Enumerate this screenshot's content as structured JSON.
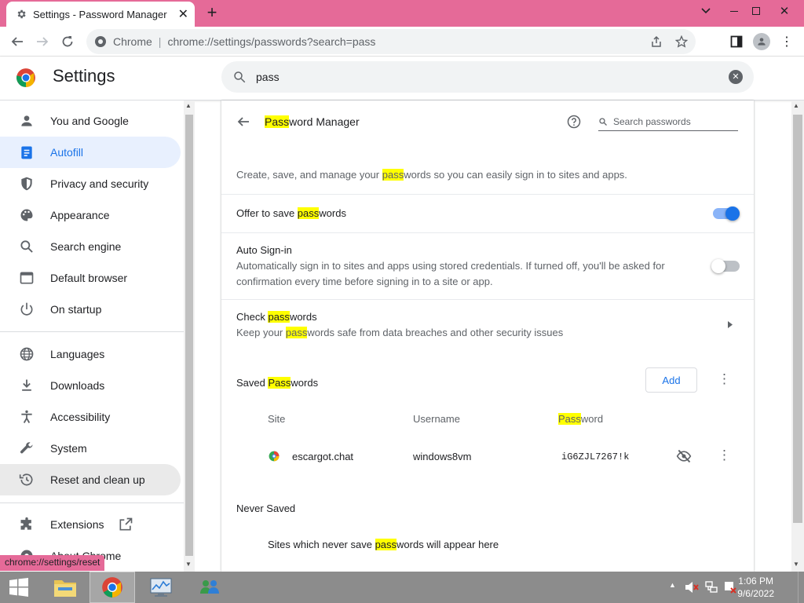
{
  "tab": {
    "title": "Settings - Password Manager"
  },
  "toolbar": {
    "omni_label": "Chrome",
    "url": "chrome://settings/passwords?search=pass"
  },
  "header": {
    "title": "Settings",
    "search_value": "pass"
  },
  "sidebar": {
    "items": [
      {
        "label": "You and Google",
        "icon": "person-icon"
      },
      {
        "label": "Autofill",
        "icon": "clipboard-icon"
      },
      {
        "label": "Privacy and security",
        "icon": "shield-icon"
      },
      {
        "label": "Appearance",
        "icon": "palette-icon"
      },
      {
        "label": "Search engine",
        "icon": "search-icon"
      },
      {
        "label": "Default browser",
        "icon": "browser-icon"
      },
      {
        "label": "On startup",
        "icon": "power-icon"
      },
      {
        "label": "Languages",
        "icon": "globe-icon"
      },
      {
        "label": "Downloads",
        "icon": "download-icon"
      },
      {
        "label": "Accessibility",
        "icon": "accessibility-icon"
      },
      {
        "label": "System",
        "icon": "wrench-icon"
      },
      {
        "label": "Reset and clean up",
        "icon": "history-icon"
      },
      {
        "label": "Extensions",
        "icon": "puzzle-icon"
      },
      {
        "label": "About Chrome",
        "icon": "chrome-icon"
      }
    ]
  },
  "pm": {
    "title_pre": "Pass",
    "title_post": "word Manager",
    "search_placeholder": "Search passwords",
    "desc_pre": "Create, save, and manage your ",
    "desc_hl": "pass",
    "desc_post": "words so you can easily sign in to sites and apps.",
    "offer_pre": "Offer to save ",
    "offer_hl": "pass",
    "offer_post": "words",
    "offer_on": true,
    "auto_title": "Auto Sign-in",
    "auto_desc1": "Automatically sign in to sites and apps using stored credentials. If turned off, you'll be asked for",
    "auto_desc2": "confirmation every time before signing in to a site or app.",
    "auto_on": false,
    "check_pre": "Check ",
    "check_hl": "pass",
    "check_post": "words",
    "check_desc_pre": "Keep your ",
    "check_desc_hl": "pass",
    "check_desc_post": "words safe from data breaches and other security issues",
    "saved_pre": "Saved ",
    "saved_hl": "Pass",
    "saved_post": "words",
    "add_label": "Add",
    "col_site": "Site",
    "col_user": "Username",
    "col_pass_hl": "Pass",
    "col_pass_post": "word",
    "entry": {
      "site": "escargot.chat",
      "username": "windows8vm",
      "password": "iG6ZJL7267!k"
    },
    "never_title": "Never Saved",
    "never_pre": "Sites which never save ",
    "never_hl": "pass",
    "never_post": "words will appear here"
  },
  "status_url": "chrome://settings/reset",
  "clock": {
    "time": "1:06 PM",
    "date": "9/6/2022"
  },
  "colors": {
    "accent": "#1a73e8",
    "titlebar": "#e56a98",
    "highlight": "#ffff00"
  }
}
